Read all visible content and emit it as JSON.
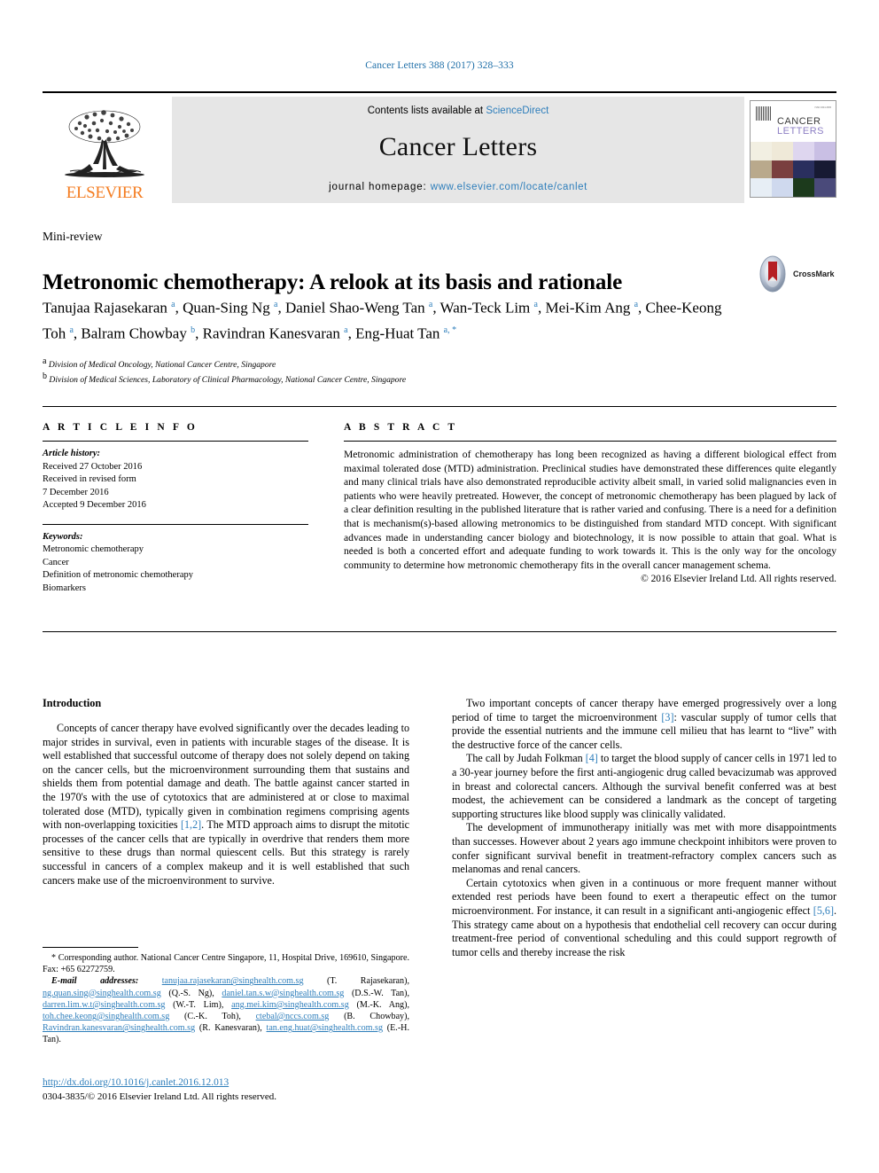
{
  "running_head": "Cancer Letters 388 (2017) 328–333",
  "masthead": {
    "publisher": "ELSEVIER",
    "contents_prefix": "Contents lists available at ",
    "contents_link": "ScienceDirect",
    "journal_title": "Cancer Letters",
    "homepage_label": "journal homepage: ",
    "homepage_url": "www.elsevier.com/locate/canlet",
    "cover": {
      "line1": "CANCER",
      "line2": "LETTERS"
    }
  },
  "article": {
    "type_label": "Mini-review",
    "title": "Metronomic chemotherapy: A relook at its basis and rationale",
    "authors_html": "Tanujaa Rajasekaran <sup>a</sup>, Quan-Sing Ng <sup>a</sup>, Daniel Shao-Weng Tan <sup>a</sup>, Wan-Teck Lim <sup>a</sup>, Mei-Kim Ang <sup>a</sup>, Chee-Keong Toh <sup>a</sup>, Balram Chowbay <sup>b</sup>, Ravindran Kanesvaran <sup>a</sup>, Eng-Huat Tan <sup>a, *</sup>",
    "affiliation_a": "Division of Medical Oncology, National Cancer Centre, Singapore",
    "affiliation_b": "Division of Medical Sciences, Laboratory of Clinical Pharmacology, National Cancer Centre, Singapore",
    "crossmark_label": "CrossMark"
  },
  "info": {
    "heading": "A R T I C L E  I N F O",
    "history_label": "Article history:",
    "history_lines": [
      "Received 27 October 2016",
      "Received in revised form",
      "7 December 2016",
      "Accepted 9 December 2016"
    ],
    "keywords_label": "Keywords:",
    "keywords": [
      "Metronomic chemotherapy",
      "Cancer",
      "Definition of metronomic chemotherapy",
      "Biomarkers"
    ]
  },
  "abstract": {
    "heading": "A B S T R A C T",
    "text": "Metronomic administration of chemotherapy has long been recognized as having a different biological effect from maximal tolerated dose (MTD) administration. Preclinical studies have demonstrated these differences quite elegantly and many clinical trials have also demonstrated reproducible activity albeit small, in varied solid malignancies even in patients who were heavily pretreated. However, the concept of metronomic chemotherapy has been plagued by lack of a clear definition resulting in the published literature that is rather varied and confusing. There is a need for a definition that is mechanism(s)-based allowing metronomics to be distinguished from standard MTD concept. With significant advances made in understanding cancer biology and biotechnology, it is now possible to attain that goal. What is needed is both a concerted effort and adequate funding to work towards it. This is the only way for the oncology community to determine how metronomic chemotherapy fits in the overall cancer management schema.",
    "copyright": "© 2016 Elsevier Ireland Ltd. All rights reserved."
  },
  "body": {
    "section_heading": "Introduction",
    "left_paragraphs": [
      "Concepts of cancer therapy have evolved significantly over the decades leading to major strides in survival, even in patients with incurable stages of the disease. It is well established that successful outcome of therapy does not solely depend on taking on the cancer cells, but the microenvironment surrounding them that sustains and shields them from potential damage and death. The battle against cancer started in the 1970's with the use of cytotoxics that are administered at or close to maximal tolerated dose (MTD), typically given in combination regimens comprising agents with non-overlapping toxicities [1,2]. The MTD approach aims to disrupt the mitotic processes of the cancer cells that are typically in overdrive that renders them more sensitive to these drugs than normal quiescent cells. But this strategy is rarely successful in cancers of a complex makeup and it is well established that such cancers make use of the microenvironment to survive."
    ],
    "right_paragraphs": [
      "Two important concepts of cancer therapy have emerged progressively over a long period of time to target the microenvironment [3]: vascular supply of tumor cells that provide the essential nutrients and the immune cell milieu that has learnt to “live” with the destructive force of the cancer cells.",
      "The call by Judah Folkman [4] to target the blood supply of cancer cells in 1971 led to a 30-year journey before the first anti-angiogenic drug called bevacizumab was approved in breast and colorectal cancers. Although the survival benefit conferred was at best modest, the achievement can be considered a landmark as the concept of targeting supporting structures like blood supply was clinically validated.",
      "The development of immunotherapy initially was met with more disappointments than successes. However about 2 years ago immune checkpoint inhibitors were proven to confer significant survival benefit in treatment-refractory complex cancers such as melanomas and renal cancers.",
      "Certain cytotoxics when given in a continuous or more frequent manner without extended rest periods have been found to exert a therapeutic effect on the tumor microenvironment. For instance, it can result in a significant anti-angiogenic effect [5,6]. This strategy came about on a hypothesis that endothelial cell recovery can occur during treatment-free period of conventional scheduling and this could support regrowth of tumor cells and thereby increase the risk"
    ]
  },
  "footnote": {
    "corresponding": "* Corresponding author. National Cancer Centre Singapore, 11, Hospital Drive, 169610, Singapore. Fax: +65 62272759.",
    "email_label": "E-mail addresses:",
    "emails": [
      {
        "address": "tanujaa.rajasekaran@singhealth.com.sg",
        "name": "(T. Rajasekaran)"
      },
      {
        "address": "ng.quan.sing@singhealth.com.sg",
        "name": "(Q.-S. Ng)"
      },
      {
        "address": "daniel.tan.s.w@singhealth.com.sg",
        "name": "(D.S.-W. Tan)"
      },
      {
        "address": "darren.lim.w.t@singhealth.com.sg",
        "name": "(W.-T. Lim)"
      },
      {
        "address": "ang.mei.kim@singhealth.com.sg",
        "name": "(M.-K. Ang)"
      },
      {
        "address": "toh.chee.keong@singhealth.com.sg",
        "name": "(C.-K. Toh)"
      },
      {
        "address": "ctebal@nccs.com.sg",
        "name": "(B. Chowbay)"
      },
      {
        "address": "Ravindran.kanesvaran@singhealth.com.sg",
        "name": "(R. Kanesvaran)"
      },
      {
        "address": "tan.eng.huat@singhealth.com.sg",
        "name": "(E.-H. Tan)"
      }
    ]
  },
  "doi": {
    "url": "http://dx.doi.org/10.1016/j.canlet.2016.12.013",
    "issn_line": "0304-3835/© 2016 Elsevier Ireland Ltd. All rights reserved."
  },
  "colors": {
    "link_blue": "#2e7ebb",
    "running_head_blue": "#1f6fa8",
    "elsevier_orange": "#F47C20"
  }
}
